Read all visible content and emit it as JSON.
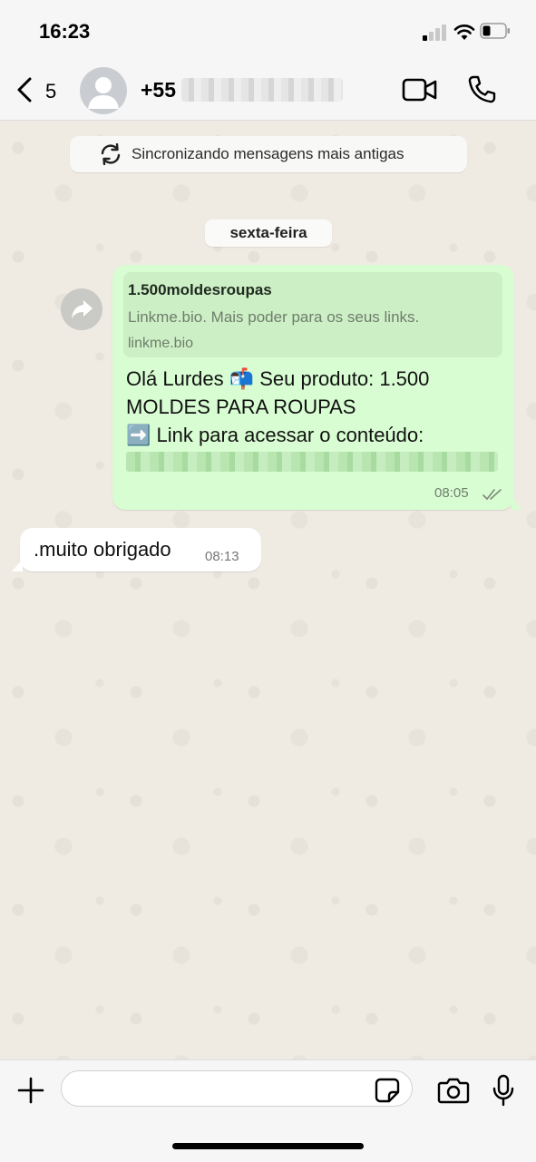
{
  "status_bar": {
    "time": "16:23"
  },
  "header": {
    "back_count": "5",
    "phone_prefix": "+55",
    "icons": [
      "chevron-left-icon",
      "avatar-icon",
      "video-camera-icon",
      "phone-icon"
    ]
  },
  "chat": {
    "sync_banner": "Sincronizando mensagens mais antigas",
    "date_separator": "sexta-feira",
    "outgoing_message": {
      "link_preview": {
        "title": "1.500moldesroupas",
        "description": "Linkme.bio. Mais poder para os seus links.",
        "host": "linkme.bio"
      },
      "line1": "Olá Lurdes 📬 Seu produto: 1.500",
      "line2": "MOLDES PARA ROUPAS",
      "line3": "➡️ Link para acessar o conteúdo:",
      "time": "08:05",
      "status": "read"
    },
    "incoming_message": {
      "text": ".muito obrigado",
      "time": "08:13"
    }
  },
  "input_bar": {
    "placeholder": "",
    "icons": [
      "plus-icon",
      "sticker-icon",
      "camera-icon",
      "microphone-icon"
    ]
  },
  "colors": {
    "outgoing_bubble": "#d9fdd3",
    "incoming_bubble": "#ffffff",
    "chat_background": "#efeae2"
  }
}
